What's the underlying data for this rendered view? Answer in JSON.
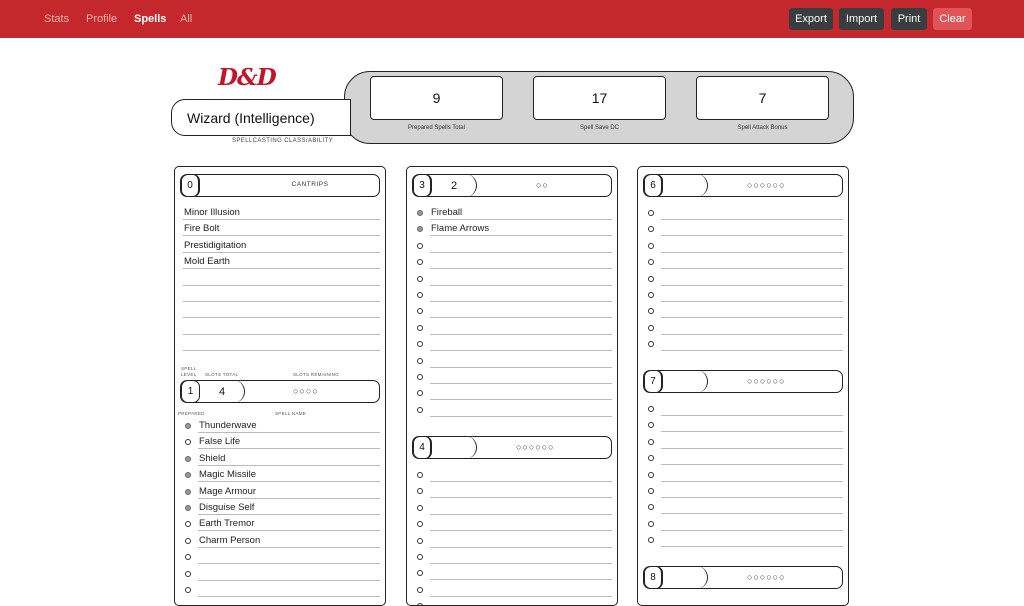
{
  "nav": {
    "links": [
      "Stats",
      "Profile",
      "Spells",
      "All"
    ],
    "active": "Spells"
  },
  "toolbar": {
    "export": "Export",
    "import": "Import",
    "print": "Print",
    "clear": "Clear"
  },
  "brand": {
    "logo": "D&D"
  },
  "header": {
    "class_ability": "Wizard (Intelligence)",
    "class_caption": "SPELLCASTING CLASS/ABILITY",
    "stats": [
      {
        "value": "9",
        "label": "Prepared Spells Total"
      },
      {
        "value": "17",
        "label": "Spell Save DC"
      },
      {
        "value": "7",
        "label": "Spell Attack Bonus"
      }
    ]
  },
  "cantrips": {
    "level": "0",
    "label": "CANTRIPS",
    "spells": [
      "Minor Illusion",
      "Fire Bolt",
      "Prestidigitation",
      "Mold Earth"
    ]
  },
  "captions": {
    "spell_level": "SPELL LEVEL",
    "slots_total": "SLOTS TOTAL",
    "slots_remaining": "SLOTS REMAINING",
    "prepared": "PREPARED",
    "spell_name": "SPELL NAME"
  },
  "levels": {
    "1": {
      "level": "1",
      "slots_total": "4",
      "bubbles": "○○○○",
      "spells": [
        {
          "name": "Thunderwave",
          "prepared": true
        },
        {
          "name": "False Life",
          "prepared": false
        },
        {
          "name": "Shield",
          "prepared": true
        },
        {
          "name": "Magic Missile",
          "prepared": true
        },
        {
          "name": "Mage Armour",
          "prepared": true
        },
        {
          "name": "Disguise Self",
          "prepared": true
        },
        {
          "name": "Earth Tremor",
          "prepared": false
        },
        {
          "name": "Charm Person",
          "prepared": false
        }
      ]
    },
    "3": {
      "level": "3",
      "slots_total": "2",
      "bubbles": "○○",
      "spells": [
        {
          "name": "Fireball",
          "prepared": true
        },
        {
          "name": "Flame Arrows",
          "prepared": true
        }
      ]
    },
    "4": {
      "level": "4",
      "slots_total": "",
      "bubbles": "○○○○○○",
      "spells": []
    },
    "6": {
      "level": "6",
      "slots_total": "",
      "bubbles": "○○○○○○",
      "spells": []
    },
    "7": {
      "level": "7",
      "slots_total": "",
      "bubbles": "○○○○○○",
      "spells": []
    },
    "8": {
      "level": "8",
      "slots_total": "",
      "bubbles": "○○○○○○",
      "spells": []
    }
  }
}
